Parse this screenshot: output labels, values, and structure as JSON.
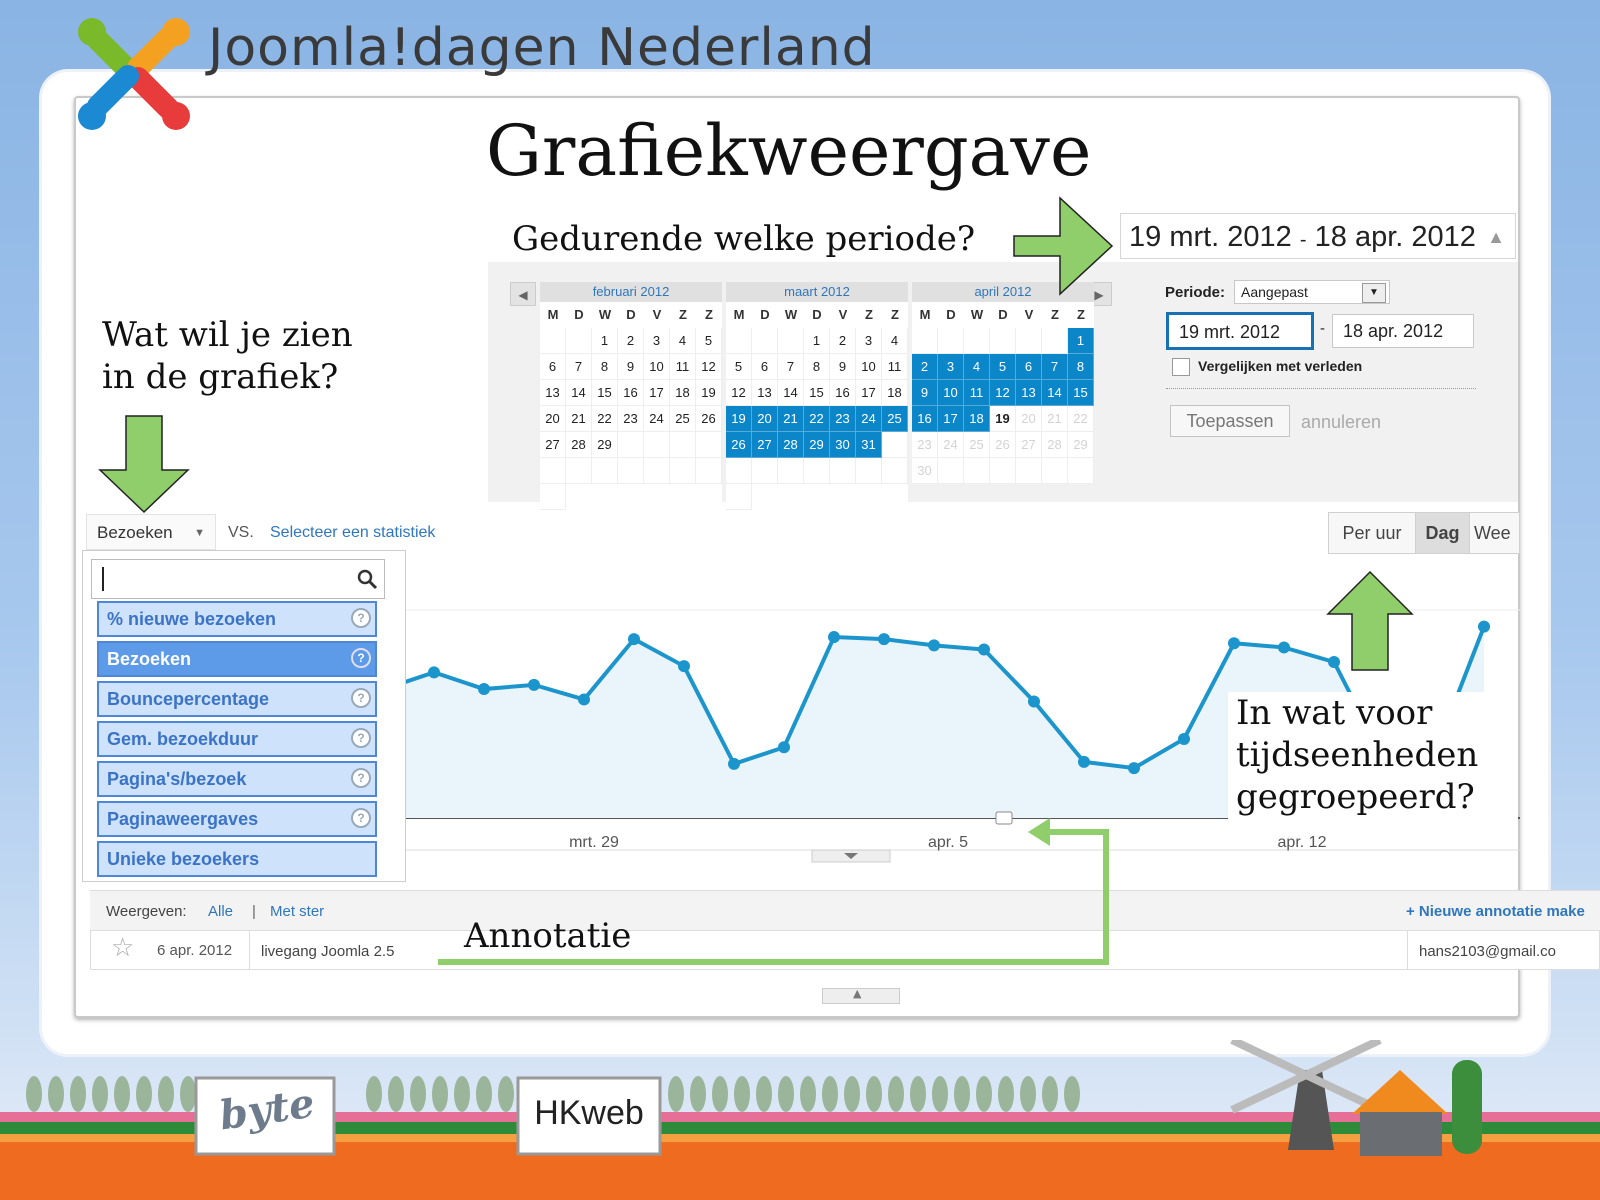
{
  "header": {
    "brand": "Joomla!dagen Nederland"
  },
  "slide_title": "Grafiekweergave",
  "callouts": {
    "period": "Gedurende welke periode?",
    "what_line1": "Wat wil je zien",
    "what_line2": "in de grafiek?",
    "units_line1": "In wat voor",
    "units_line2": "tijdseenheden",
    "units_line3": "gegroepeerd?",
    "annotation": "Annotatie"
  },
  "date_range": {
    "start": "19 mrt. 2012",
    "sep": "-",
    "end": "18 apr. 2012"
  },
  "calendars": {
    "day_names": [
      "M",
      "D",
      "W",
      "D",
      "V",
      "Z",
      "Z"
    ],
    "months": [
      {
        "label": "februari 2012",
        "cells": [
          "",
          "",
          "1",
          "2",
          "3",
          "4",
          "5",
          "6",
          "7",
          "8",
          "9",
          "10",
          "11",
          "12",
          "13",
          "14",
          "15",
          "16",
          "17",
          "18",
          "19",
          "20",
          "21",
          "22",
          "23",
          "24",
          "25",
          "26",
          "27",
          "28",
          "29",
          "",
          "",
          "",
          "",
          "",
          "",
          "",
          "",
          "",
          "",
          "",
          ""
        ]
      },
      {
        "label": "maart 2012",
        "cells": [
          "",
          "",
          "",
          "1",
          "2",
          "3",
          "4",
          "5",
          "6",
          "7",
          "8",
          "9",
          "10",
          "11",
          "12",
          "13",
          "14",
          "15",
          "16",
          "17",
          "18",
          "19",
          "20",
          "21",
          "22",
          "23",
          "24",
          "25",
          "26",
          "27",
          "28",
          "29",
          "30",
          "31",
          "",
          "",
          "",
          "",
          "",
          "",
          "",
          "",
          ""
        ]
      },
      {
        "label": "april 2012",
        "cells": [
          "",
          "",
          "",
          "",
          "",
          "",
          "1",
          "2",
          "3",
          "4",
          "5",
          "6",
          "7",
          "8",
          "9",
          "10",
          "11",
          "12",
          "13",
          "14",
          "15",
          "16",
          "17",
          "18",
          "19",
          "20",
          "21",
          "22",
          "23",
          "24",
          "25",
          "26",
          "27",
          "28",
          "29",
          "30",
          "",
          "",
          "",
          "",
          "",
          ""
        ]
      }
    ]
  },
  "period_form": {
    "period_label": "Periode:",
    "period_value": "Aangepast",
    "start": "19 mrt. 2012",
    "dash": "-",
    "end": "18 apr. 2012",
    "compare_label": "Vergelijken met verleden",
    "apply": "Toepassen",
    "cancel": "annuleren"
  },
  "metrics": {
    "selected": "Bezoeken",
    "vs": "VS.",
    "select_stat": "Selecteer een statistiek",
    "items": [
      "% nieuwe bezoeken",
      "Bezoeken",
      "Bouncepercentage",
      "Gem. bezoekduur",
      "Pagina's/bezoek",
      "Paginaweergaves",
      "Unieke bezoekers"
    ],
    "active_index": 1,
    "help": "?"
  },
  "time_buttons": [
    "Per uur",
    "Dag",
    "Wee"
  ],
  "chart_data": {
    "type": "line",
    "x_ticks": [
      "mrt. 29",
      "apr. 5",
      "apr. 12"
    ],
    "values": [
      0.62,
      0.7,
      0.62,
      0.64,
      0.57,
      0.86,
      0.73,
      0.26,
      0.34,
      0.87,
      0.86,
      0.83,
      0.81,
      0.56,
      0.27,
      0.24,
      0.38,
      0.84,
      0.82,
      0.75,
      0.28,
      0.3,
      0.92
    ],
    "ylim": [
      0,
      1
    ]
  },
  "annotations": {
    "show_label": "Weergeven:",
    "all": "Alle",
    "divider": "|",
    "starred": "Met ster",
    "new": "+ Nieuwe annotatie make",
    "row": {
      "star": "☆",
      "date": "6 apr. 2012",
      "text": "livegang Joomla 2.5",
      "user": "hans2103@gmail.co"
    }
  },
  "sponsors": [
    "byte",
    "HKweb"
  ],
  "colors": {
    "line": "#1b95cb",
    "selected_day": "#0b86c9",
    "arrow": "#8fce6a",
    "link": "#2f77bd"
  }
}
